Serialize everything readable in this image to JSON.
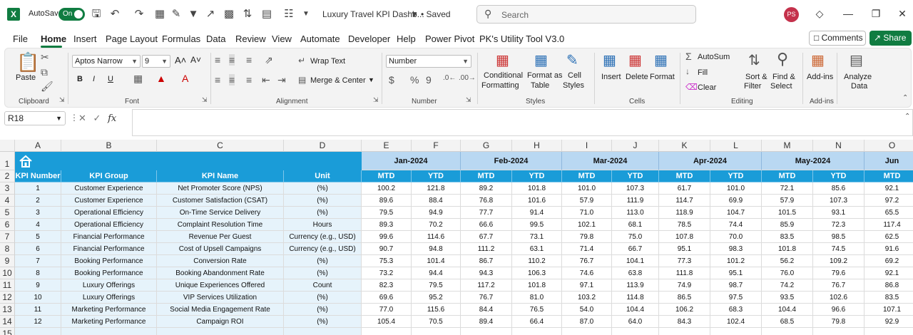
{
  "window": {
    "autosave_label": "AutoSave",
    "autosave_state": "On",
    "doc_title": "Luxury Travel KPI Dashb...",
    "saved_status": "• Saved",
    "search_placeholder": "Search",
    "user_initials": "PS"
  },
  "menu": {
    "tabs": [
      "File",
      "Home",
      "Insert",
      "Page Layout",
      "Formulas",
      "Data",
      "Review",
      "View",
      "Automate",
      "Developer",
      "Help",
      "Power Pivot",
      "PK's Utility Tool V3.0"
    ],
    "active": "Home",
    "comments_label": "Comments",
    "share_label": "Share"
  },
  "ribbon": {
    "clipboard": {
      "paste": "Paste",
      "label": "Clipboard"
    },
    "font": {
      "name": "Aptos Narrow",
      "size": "9",
      "label": "Font",
      "bold": "B",
      "italic": "I",
      "underline": "U"
    },
    "alignment": {
      "wrap": "Wrap Text",
      "merge": "Merge & Center",
      "label": "Alignment"
    },
    "number": {
      "format": "Number",
      "label": "Number"
    },
    "styles": {
      "conditional1": "Conditional",
      "conditional2": "Formatting",
      "format_as1": "Format as",
      "format_as2": "Table",
      "cell_styles1": "Cell",
      "cell_styles2": "Styles",
      "label": "Styles"
    },
    "cells": {
      "insert": "Insert",
      "delete": "Delete",
      "format": "Format",
      "label": "Cells"
    },
    "editing": {
      "autosum": "AutoSum",
      "fill": "Fill",
      "clear": "Clear",
      "sort1": "Sort &",
      "sort2": "Filter",
      "find1": "Find &",
      "find2": "Select",
      "label": "Editing"
    },
    "addins": {
      "addins": "Add-ins",
      "label": "Add-ins"
    },
    "analyze": {
      "line1": "Analyze",
      "line2": "Data"
    }
  },
  "formula_bar": {
    "name_box": "R18",
    "fx": "fx",
    "value": ""
  },
  "grid": {
    "columns": [
      "A",
      "B",
      "C",
      "D",
      "E",
      "F",
      "G",
      "H",
      "I",
      "J",
      "K",
      "L",
      "M",
      "N",
      "O"
    ],
    "rows": [
      "1",
      "2",
      "3",
      "4",
      "5",
      "6",
      "7",
      "8",
      "9",
      "10",
      "11",
      "12",
      "13",
      "14",
      "15"
    ],
    "months": [
      "Jan-2024",
      "Feb-2024",
      "Mar-2024",
      "Apr-2024",
      "May-2024",
      "Jun"
    ],
    "headers": [
      "KPI Number",
      "KPI Group",
      "KPI Name",
      "Unit"
    ],
    "sub_headers": [
      "MTD",
      "YTD",
      "MTD",
      "YTD",
      "MTD",
      "YTD",
      "MTD",
      "YTD",
      "MTD",
      "YTD",
      "MTD"
    ],
    "records": [
      {
        "num": "1",
        "group": "Customer Experience",
        "name": "Net Promoter Score (NPS)",
        "unit": "(%)",
        "vals": [
          "100.2",
          "121.8",
          "89.2",
          "101.8",
          "101.0",
          "107.3",
          "61.7",
          "101.0",
          "72.1",
          "85.6",
          "92.1"
        ]
      },
      {
        "num": "2",
        "group": "Customer Experience",
        "name": "Customer Satisfaction (CSAT)",
        "unit": "(%)",
        "vals": [
          "89.6",
          "88.4",
          "76.8",
          "101.6",
          "57.9",
          "111.9",
          "114.7",
          "69.9",
          "57.9",
          "107.3",
          "97.2"
        ]
      },
      {
        "num": "3",
        "group": "Operational Efficiency",
        "name": "On-Time Service Delivery",
        "unit": "(%)",
        "vals": [
          "79.5",
          "94.9",
          "77.7",
          "91.4",
          "71.0",
          "113.0",
          "118.9",
          "104.7",
          "101.5",
          "93.1",
          "65.5"
        ]
      },
      {
        "num": "4",
        "group": "Operational Efficiency",
        "name": "Complaint Resolution Time",
        "unit": "Hours",
        "vals": [
          "89.3",
          "70.2",
          "66.6",
          "99.5",
          "102.1",
          "68.1",
          "78.5",
          "74.4",
          "85.9",
          "72.3",
          "117.4"
        ]
      },
      {
        "num": "5",
        "group": "Financial Performance",
        "name": "Revenue Per Guest",
        "unit": "Currency (e.g., USD)",
        "vals": [
          "99.6",
          "114.6",
          "67.7",
          "73.1",
          "79.8",
          "75.0",
          "107.8",
          "70.0",
          "83.5",
          "98.5",
          "62.5"
        ]
      },
      {
        "num": "6",
        "group": "Financial Performance",
        "name": "Cost of Upsell Campaigns",
        "unit": "Currency (e.g., USD)",
        "vals": [
          "90.7",
          "94.8",
          "111.2",
          "63.1",
          "71.4",
          "66.7",
          "95.1",
          "98.3",
          "101.8",
          "74.5",
          "91.6"
        ]
      },
      {
        "num": "7",
        "group": "Booking Performance",
        "name": "Conversion Rate",
        "unit": "(%)",
        "vals": [
          "75.3",
          "101.4",
          "86.7",
          "110.2",
          "76.7",
          "104.1",
          "77.3",
          "101.2",
          "56.2",
          "109.2",
          "69.2"
        ]
      },
      {
        "num": "8",
        "group": "Booking Performance",
        "name": "Booking Abandonment Rate",
        "unit": "(%)",
        "vals": [
          "73.2",
          "94.4",
          "94.3",
          "106.3",
          "74.6",
          "63.8",
          "111.8",
          "95.1",
          "76.0",
          "79.6",
          "92.1"
        ]
      },
      {
        "num": "9",
        "group": "Luxury Offerings",
        "name": "Unique Experiences Offered",
        "unit": "Count",
        "vals": [
          "82.3",
          "79.5",
          "117.2",
          "101.8",
          "97.1",
          "113.9",
          "74.9",
          "98.7",
          "74.2",
          "76.7",
          "86.8"
        ]
      },
      {
        "num": "10",
        "group": "Luxury Offerings",
        "name": "VIP Services Utilization",
        "unit": "(%)",
        "vals": [
          "69.6",
          "95.2",
          "76.7",
          "81.0",
          "103.2",
          "114.8",
          "86.5",
          "97.5",
          "93.5",
          "102.6",
          "83.5"
        ]
      },
      {
        "num": "11",
        "group": "Marketing Performance",
        "name": "Social Media Engagement Rate",
        "unit": "(%)",
        "vals": [
          "77.0",
          "115.6",
          "84.4",
          "76.5",
          "54.0",
          "104.4",
          "106.2",
          "68.3",
          "104.4",
          "96.6",
          "107.1"
        ]
      },
      {
        "num": "12",
        "group": "Marketing Performance",
        "name": "Campaign ROI",
        "unit": "(%)",
        "vals": [
          "105.4",
          "70.5",
          "89.4",
          "66.4",
          "87.0",
          "64.0",
          "84.3",
          "102.4",
          "68.5",
          "79.8",
          "92.9"
        ]
      }
    ]
  },
  "colors": {
    "accent": "#107c41",
    "header_blue": "#1a9cd8",
    "month_blue": "#b9d8f2",
    "light_cell": "#e6f3fb"
  }
}
